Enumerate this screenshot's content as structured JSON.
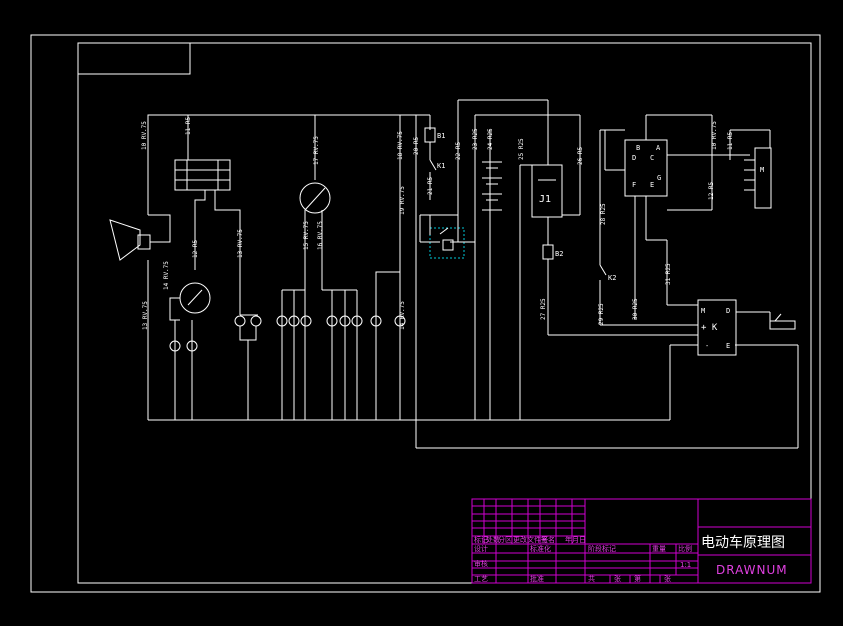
{
  "title_block": {
    "drawing_title": "电动车原理图",
    "drawing_number": "DRAWNUM",
    "row_labels": [
      "设计",
      "审核",
      "工艺"
    ],
    "header_cells": [
      "标记",
      "处数",
      "分区",
      "更改文件号",
      "签名",
      "年月日"
    ],
    "mid_labels": [
      "标准化",
      "批准"
    ],
    "right_labels": [
      "阶段标记",
      "重量",
      "比例"
    ],
    "bottom_labels": [
      "共",
      "张",
      "第",
      "张"
    ],
    "scale": "1:1"
  },
  "components": {
    "b1": "B1",
    "k1": "K1",
    "j1": "J1",
    "b2": "B2",
    "k2": "K2",
    "controller": {
      "m": "M",
      "plus_k": "+ K",
      "minus": "-",
      "d": "D",
      "e": "E"
    },
    "switch_block": {
      "b": "B",
      "a": "A",
      "d": "D",
      "c": "C",
      "f": "F",
      "e": "E",
      "g": "G"
    },
    "motor_label": "M"
  },
  "wire_labels": [
    "10 RV.75",
    "11 R5",
    "12 R5",
    "13 RV.75",
    "14 RV.75",
    "15 RV.75",
    "16 RV.75",
    "17 RV.75",
    "18 RV.75",
    "19 RV.75",
    "20 R5",
    "21 R5",
    "22 R5",
    "23 R25",
    "24 R25",
    "25 R25",
    "26 R5",
    "27 R25",
    "28 R25",
    "29 R25",
    "30 R25",
    "31 R25"
  ]
}
